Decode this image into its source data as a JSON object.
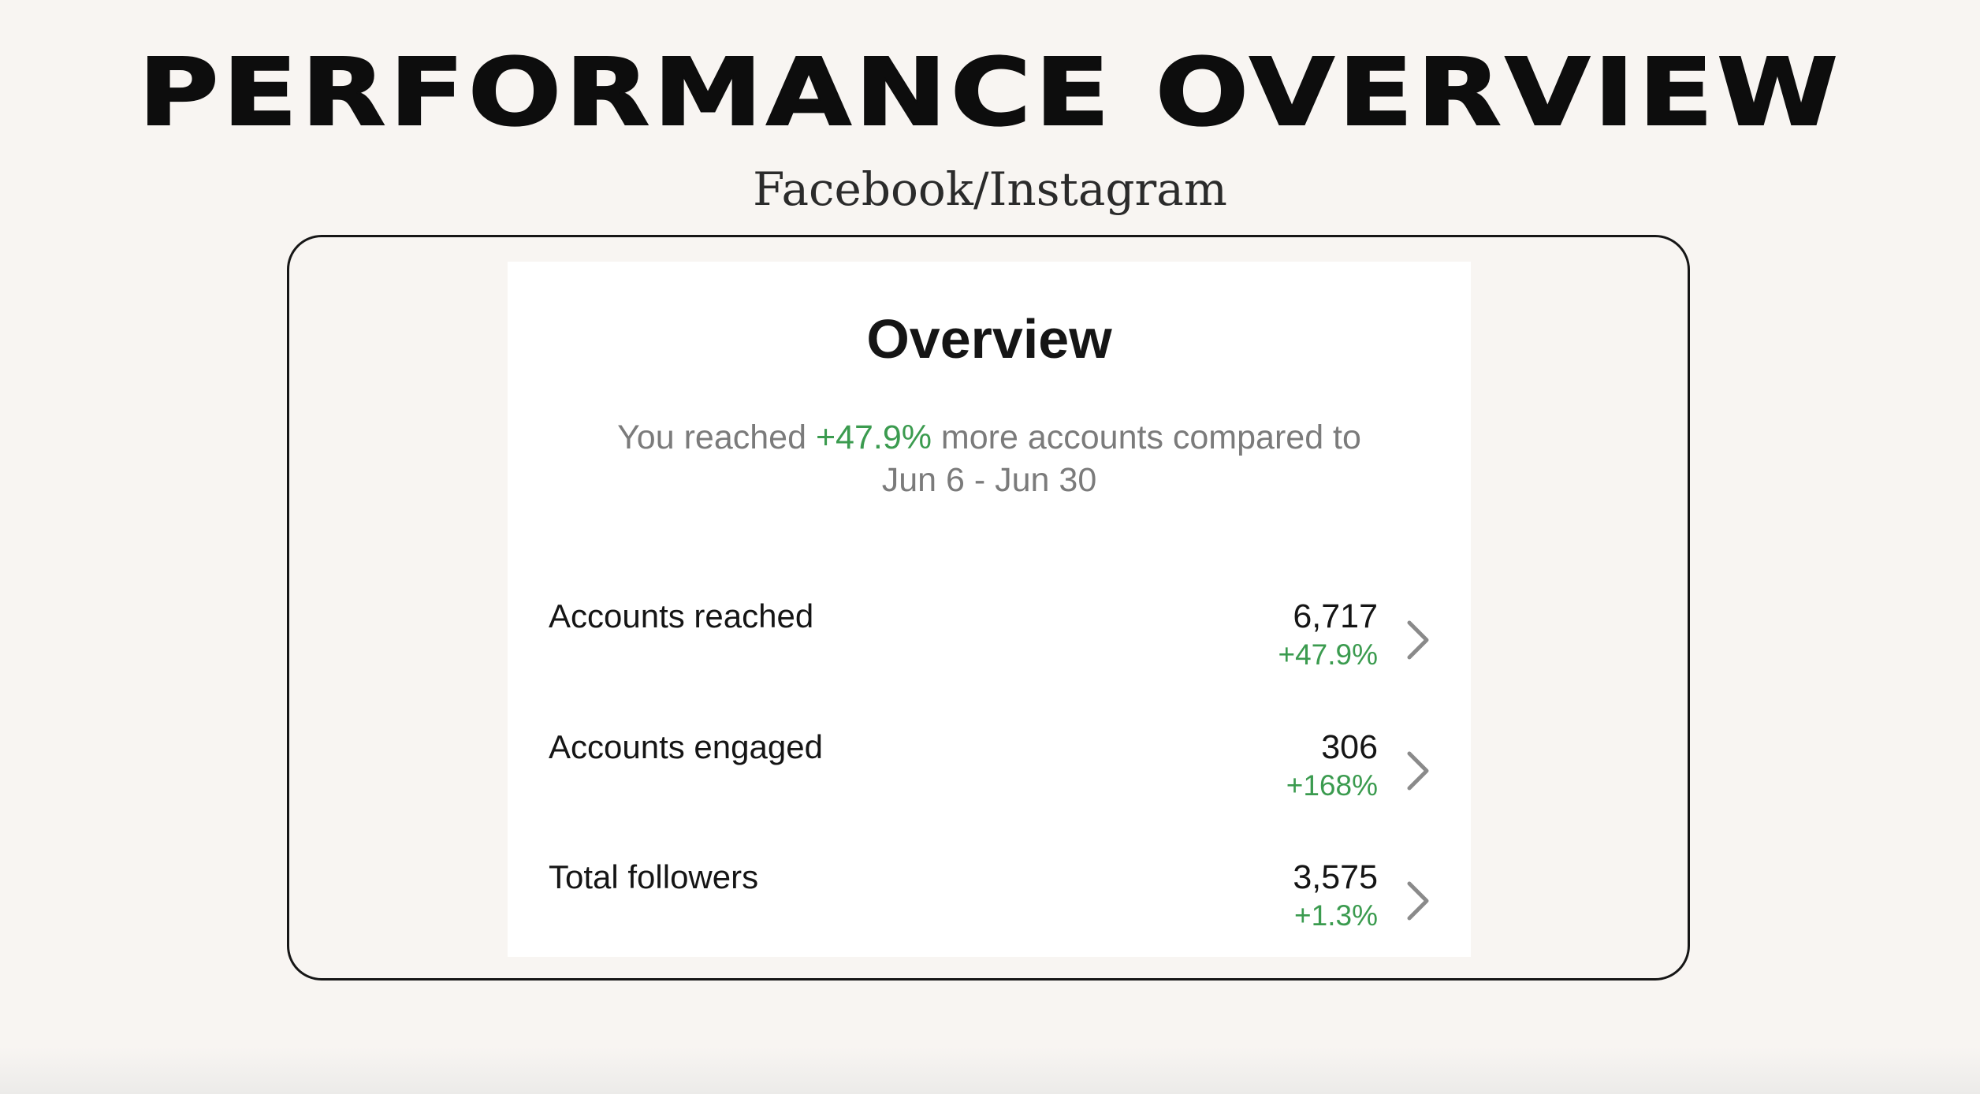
{
  "header": {
    "title": "PERFORMANCE OVERVIEW",
    "subtitle": "Facebook/Instagram"
  },
  "overview": {
    "title": "Overview",
    "summary_prefix": "You reached ",
    "summary_pct": "+47.9%",
    "summary_suffix": " more accounts compared to",
    "summary_period": "Jun 6 - Jun 30",
    "metrics": [
      {
        "label": "Accounts reached",
        "value": "6,717",
        "change": "+47.9%"
      },
      {
        "label": "Accounts engaged",
        "value": "306",
        "change": "+168%"
      },
      {
        "label": "Total followers",
        "value": "3,575",
        "change": "+1.3%"
      }
    ]
  },
  "colors": {
    "background": "#f8f5f2",
    "positive": "#3b9b4f",
    "muted_text": "#7b7b7b"
  },
  "icons": {
    "row_chevron": "chevron-right-icon"
  }
}
